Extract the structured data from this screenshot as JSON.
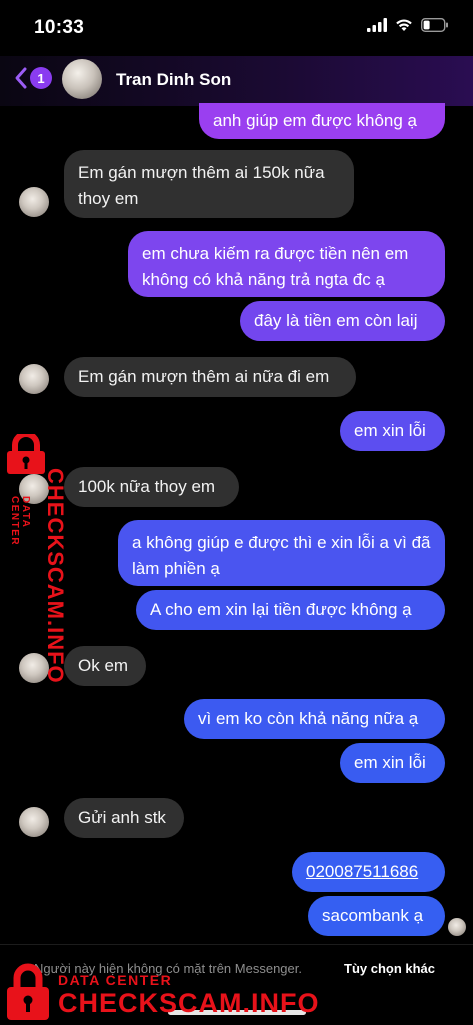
{
  "status_bar": {
    "time": "10:33"
  },
  "header": {
    "back_count": "1",
    "contact_name": "Tran Dinh Son"
  },
  "messages": [
    {
      "dir": "out",
      "text": "anh giúp em được không ạ"
    },
    {
      "dir": "in",
      "text": "Em gán mượn thêm ai 150k nữa thoy em"
    },
    {
      "dir": "out",
      "text": "em chưa kiếm ra được tiền nên em không có khả năng trả ngta đc ạ"
    },
    {
      "dir": "out",
      "text": "đây là tiền em còn laij"
    },
    {
      "dir": "in",
      "text": "Em gán mượn thêm ai nữa đi em"
    },
    {
      "dir": "out",
      "text": "em xin lỗi"
    },
    {
      "dir": "in",
      "text": "100k nữa thoy em"
    },
    {
      "dir": "out",
      "text": "a không giúp e được thì e xin lỗi a vì đã làm phiền ạ"
    },
    {
      "dir": "out",
      "text": "A cho em xin lại tiền được không ạ"
    },
    {
      "dir": "in",
      "text": "Ok em"
    },
    {
      "dir": "out",
      "text": "vì em ko còn khả năng nữa ạ"
    },
    {
      "dir": "out",
      "text": "em xin lỗi"
    },
    {
      "dir": "in",
      "text": "Gửi anh stk"
    },
    {
      "dir": "out",
      "text": "020087511686"
    },
    {
      "dir": "out",
      "text": "sacombank ạ"
    }
  ],
  "footer": {
    "note": "Người này hiện không có mặt trên Messenger.",
    "options": "Tùy chọn khác"
  },
  "watermark": {
    "label": "DATA CENTER",
    "site": "CHECKSCAM.INFO"
  },
  "colors": {
    "incoming": "#303030",
    "out_top": "#9a3ff0",
    "out_bottom": "#3a5cf2",
    "watermark": "#e8121a"
  }
}
